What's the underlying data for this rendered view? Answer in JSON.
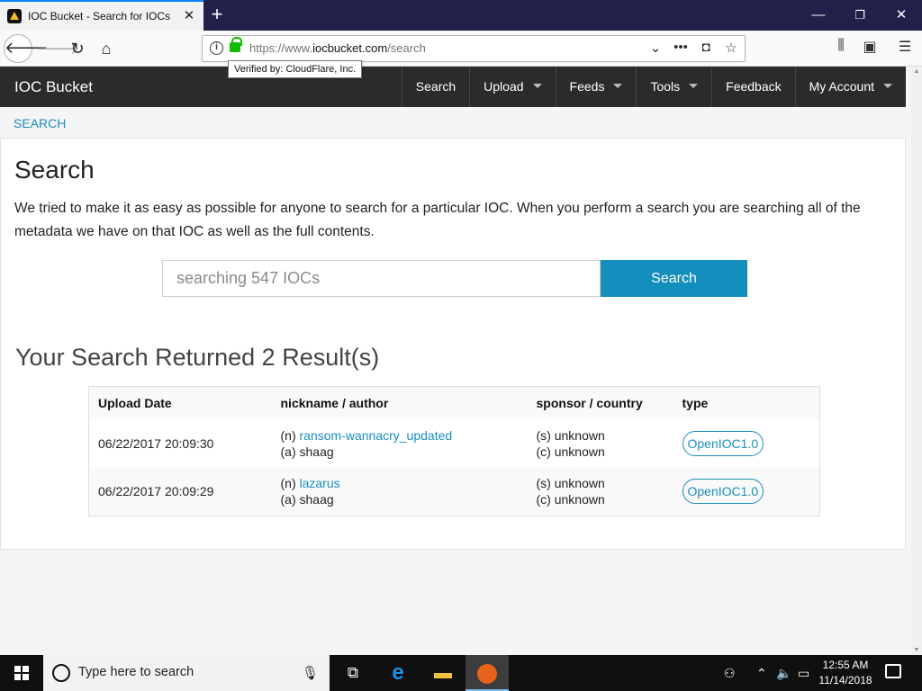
{
  "browser": {
    "tab_title": "IOC Bucket - Search for IOCs",
    "tab_close": "✕",
    "new_tab": "+",
    "url_protocol": "https://www.",
    "url_domain": "iocbucket.com",
    "url_path": "/search",
    "tooltip": "Verified by: CloudFlare, Inc.",
    "window_controls": {
      "minimize": "—",
      "restore": "❐",
      "close": "✕"
    }
  },
  "site": {
    "brand": "IOC Bucket",
    "menu": [
      {
        "label": "Search",
        "dropdown": false
      },
      {
        "label": "Upload",
        "dropdown": true
      },
      {
        "label": "Feeds",
        "dropdown": true
      },
      {
        "label": "Tools",
        "dropdown": true
      },
      {
        "label": "Feedback",
        "dropdown": false
      },
      {
        "label": "My Account",
        "dropdown": true
      }
    ],
    "breadcrumb": "SEARCH"
  },
  "main": {
    "title": "Search",
    "intro": "We tried to make it as easy as possible for anyone to search for a particular IOC. When you perform a search you are searching all of the metadata we have on that IOC as well as the full contents.",
    "search_placeholder": "searching 547 IOCs",
    "search_value": "",
    "search_button": "Search",
    "results_title": "Your Search Returned 2 Result(s)"
  },
  "results_table": {
    "headers": [
      "Upload Date",
      "nickname / author",
      "sponsor / country",
      "type"
    ],
    "rows": [
      {
        "date": "06/22/2017 20:09:30",
        "nick_prefix": "(n) ",
        "nickname": "ransom-wannacry_updated",
        "author": "(a) shaag",
        "sponsor": "(s) unknown",
        "country": "(c) unknown",
        "type": "OpenIOC1.0"
      },
      {
        "date": "06/22/2017 20:09:29",
        "nick_prefix": "(n) ",
        "nickname": "lazarus",
        "author": "(a) shaag",
        "sponsor": "(s) unknown",
        "country": "(c) unknown",
        "type": "OpenIOC1.0"
      }
    ]
  },
  "taskbar": {
    "search_placeholder": "Type here to search",
    "time": "12:55 AM",
    "date": "11/14/2018"
  },
  "colors": {
    "accent": "#138fbd",
    "link": "#1a8ebd",
    "navbar": "#2b2b2b",
    "titlebar": "#20204a",
    "taskbar": "#101010"
  }
}
